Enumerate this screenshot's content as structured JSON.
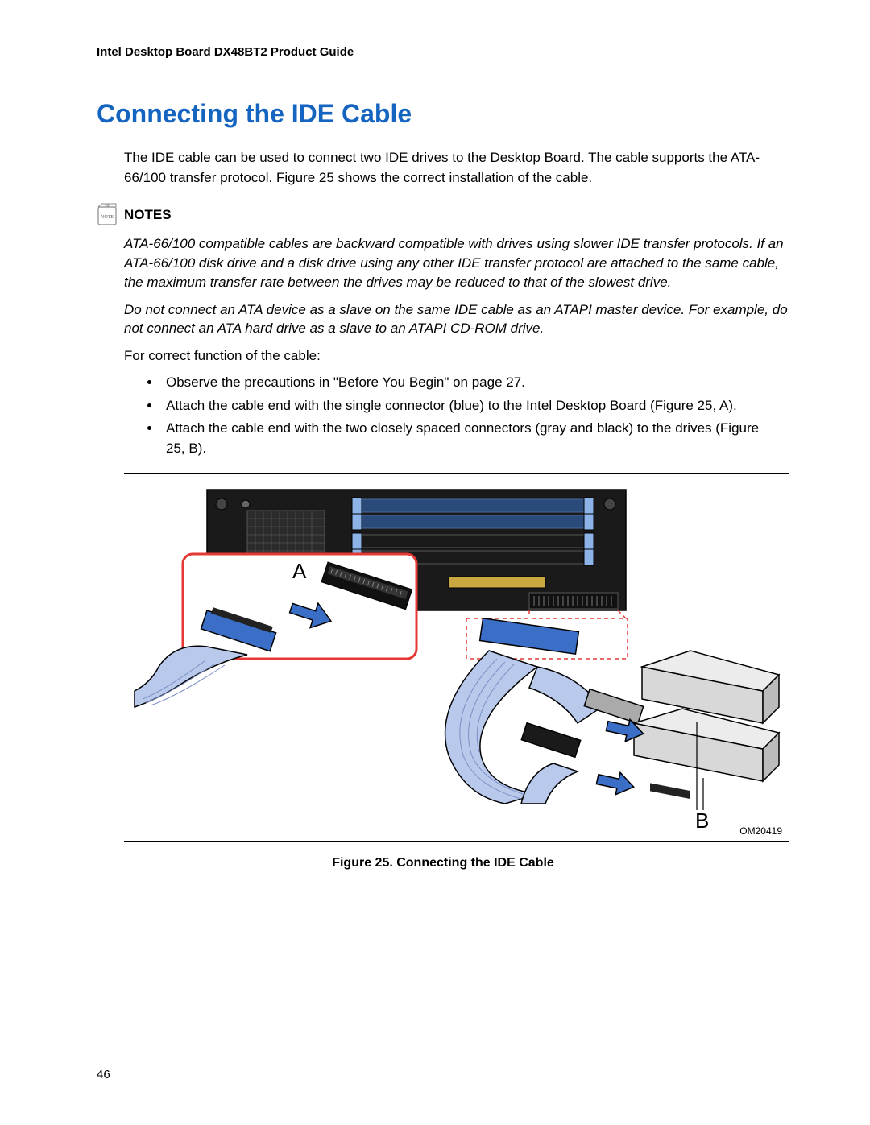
{
  "header": "Intel Desktop Board DX48BT2 Product Guide",
  "title": "Connecting the IDE Cable",
  "intro": "The IDE cable can be used to connect two IDE drives to the Desktop Board.  The cable supports the ATA-66/100 transfer protocol.  Figure 25 shows the correct installation of the cable.",
  "notes_heading": "NOTES",
  "note1": "ATA-66/100 compatible cables are backward compatible with drives using slower IDE transfer protocols.  If an ATA-66/100 disk drive and a disk drive using any other IDE transfer protocol are attached to the same cable, the maximum transfer rate between the drives may be reduced to that of the slowest drive.",
  "note2": "Do not connect an ATA device as a slave on the same IDE cable as an ATAPI master device.  For example, do not connect an ATA hard drive as a slave to an ATAPI CD-ROM drive.",
  "post_note": "For correct function of the cable:",
  "bullets": [
    "Observe the precautions in \"Before You Begin\" on page 27.",
    "Attach the cable end with the single connector (blue) to the Intel Desktop Board (Figure 25, A).",
    "Attach the cable end with the two closely spaced connectors (gray and black) to the drives (Figure 25, B)."
  ],
  "figure": {
    "label_a": "A",
    "label_b": "B",
    "code": "OM20419",
    "caption": "Figure 25.  Connecting the IDE Cable"
  },
  "page_number": "46"
}
